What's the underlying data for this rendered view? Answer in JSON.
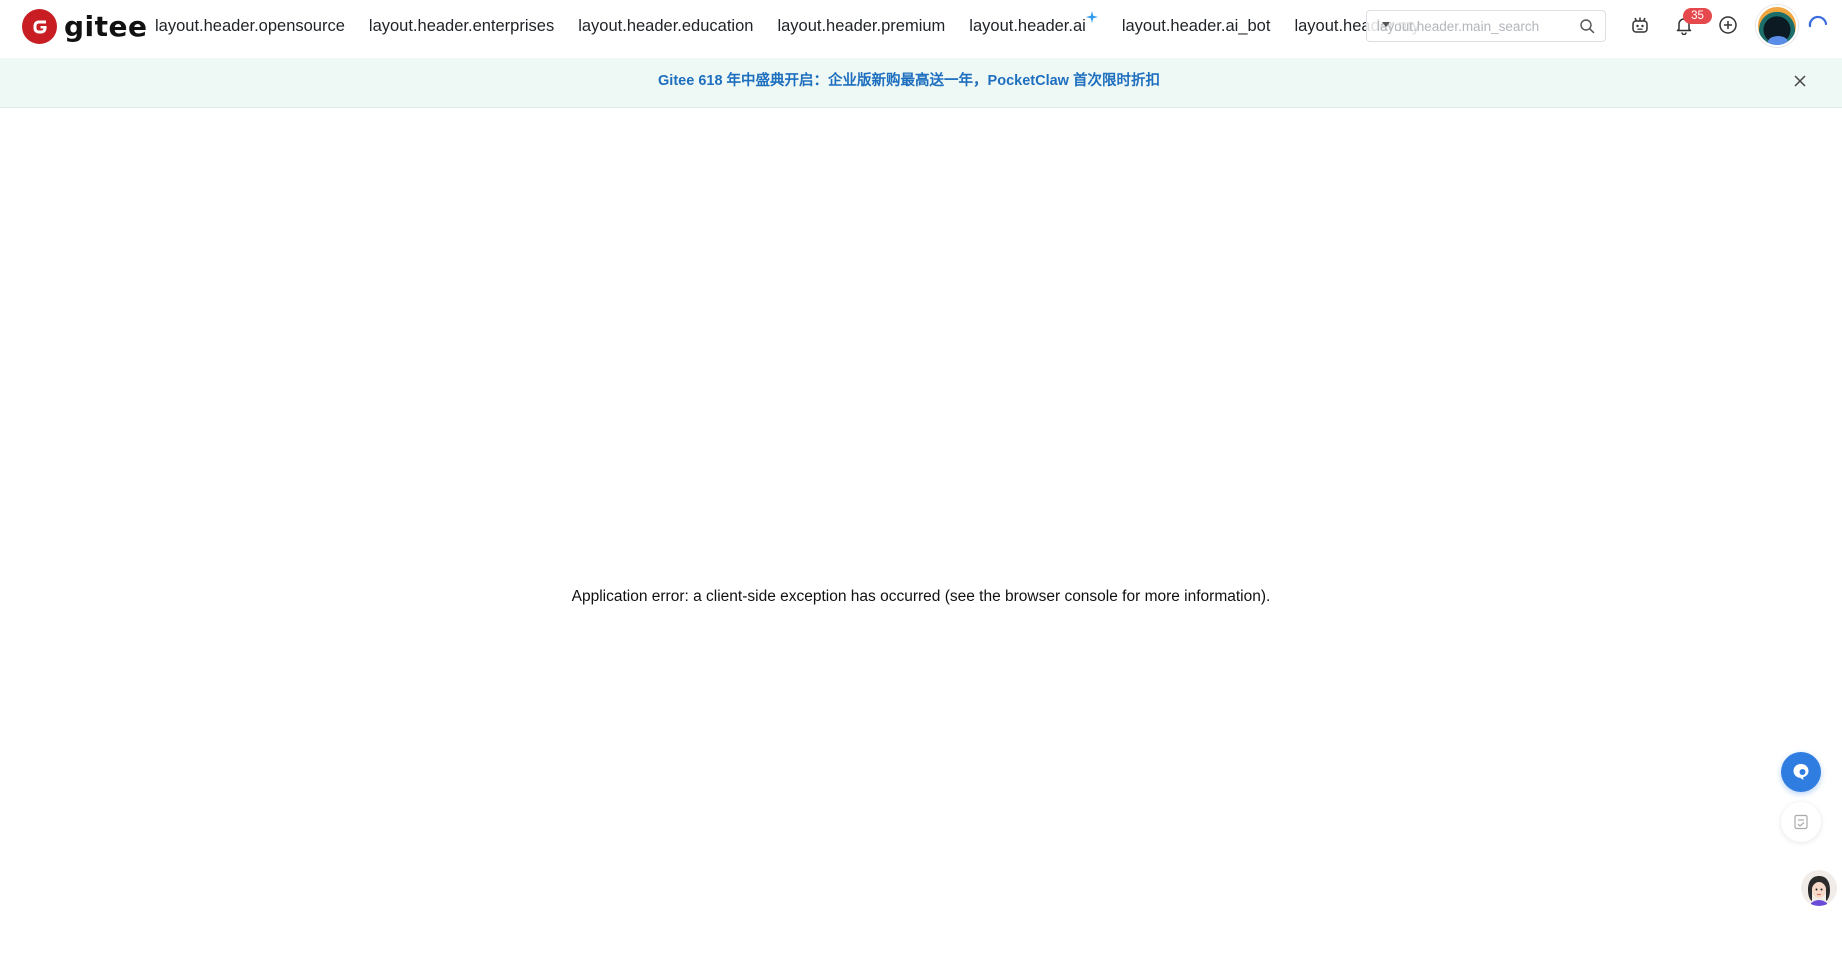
{
  "header": {
    "logo_text": "gitee",
    "nav": [
      "layout.header.opensource",
      "layout.header.enterprises",
      "layout.header.education",
      "layout.header.premium",
      "layout.header.ai",
      "layout.header.ai_bot",
      "layout.header.my"
    ],
    "search_placeholder": "layout.header.main_search",
    "notifications_count": "35"
  },
  "banner": {
    "text": "Gitee 618 年中盛典开启：企业版新购最高送一年，PocketClaw 首次限时折扣"
  },
  "main": {
    "error_message": "Application error: a client-side exception has occurred (see the browser console for more information)."
  },
  "colors": {
    "brand_red": "#c71d23",
    "banner_bg": "#eef8f4",
    "banner_text": "#1e6fbf",
    "badge": "#e5484d",
    "float_blue": "#2f7de1"
  },
  "icons": {
    "sparkle": "sparkle-icon",
    "search": "search-icon",
    "bot": "robot-icon",
    "bell": "bell-icon",
    "plus": "plus-circle-icon",
    "refresh": "refresh-icon",
    "close": "close-icon",
    "chat": "chat-icon",
    "feedback": "feedback-icon",
    "assistant": "assistant-avatar-icon"
  }
}
